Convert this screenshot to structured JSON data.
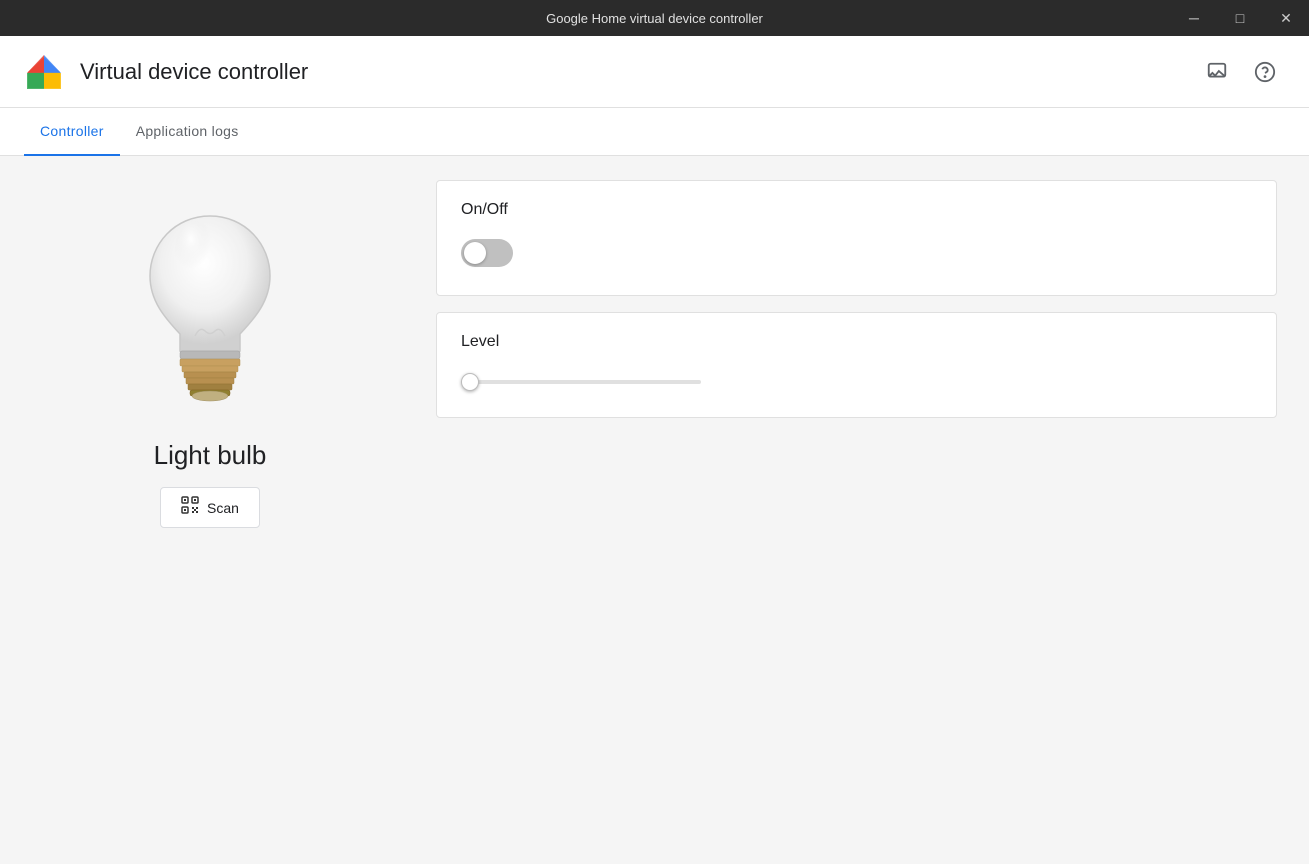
{
  "titlebar": {
    "title": "Google Home virtual device controller",
    "minimize_label": "─",
    "maximize_label": "□",
    "close_label": "✕"
  },
  "header": {
    "app_title": "Virtual device controller",
    "feedback_icon": "feedback",
    "help_icon": "help"
  },
  "tabs": [
    {
      "id": "controller",
      "label": "Controller",
      "active": true
    },
    {
      "id": "application-logs",
      "label": "Application logs",
      "active": false
    }
  ],
  "device": {
    "name": "Light bulb",
    "scan_button_label": "Scan"
  },
  "controls": {
    "on_off": {
      "label": "On/Off",
      "value": false
    },
    "level": {
      "label": "Level",
      "value": 0,
      "min": 0,
      "max": 100
    }
  }
}
